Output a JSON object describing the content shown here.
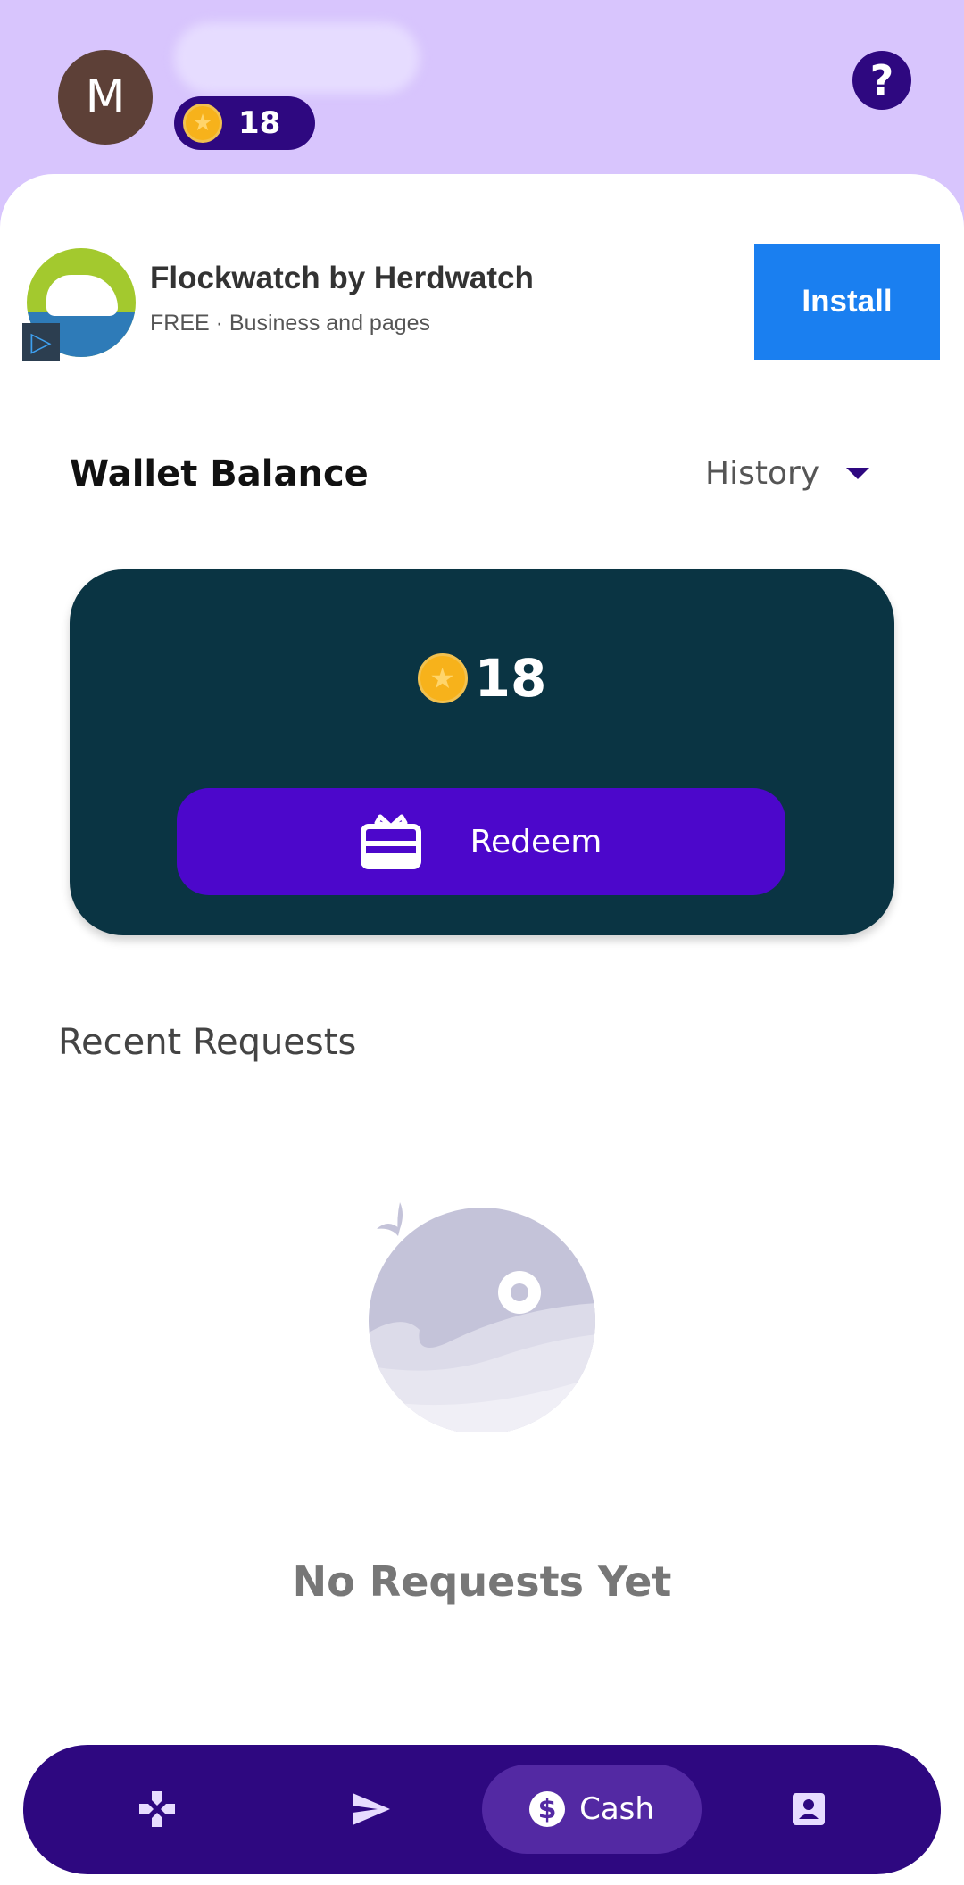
{
  "header": {
    "avatar_initial": "M",
    "coin_count": "18",
    "help_label": "?"
  },
  "ad": {
    "title": "Flockwatch by Herdwatch",
    "subtitle": "FREE · Business and pages",
    "install_label": "Install",
    "badge_glyph": "▷"
  },
  "wallet": {
    "title": "Wallet Balance",
    "history_label": "History",
    "balance": "18",
    "redeem_label": "Redeem"
  },
  "recent": {
    "title": "Recent Requests",
    "empty_text": "No Requests Yet"
  },
  "nav": {
    "cash_label": "Cash",
    "items": [
      {
        "icon": "gamepad-icon"
      },
      {
        "icon": "send-icon"
      },
      {
        "icon": "dollar-icon"
      },
      {
        "icon": "profile-icon"
      }
    ]
  },
  "colors": {
    "header_bg": "#d8c5fd",
    "accent": "#2e0880",
    "card_bg": "#0a3443",
    "redeem_bg": "#4c07cb",
    "install_bg": "#1a7ff0",
    "coin": "#f7b21b"
  }
}
